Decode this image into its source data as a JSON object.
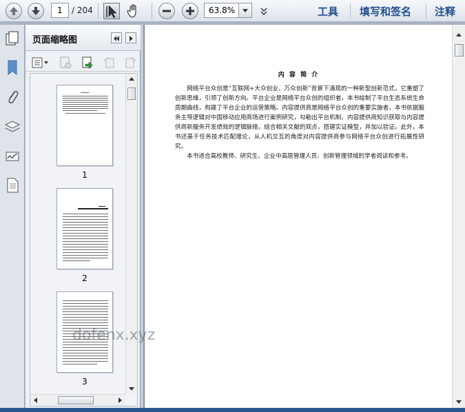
{
  "toolbar": {
    "current_page": "1",
    "total_pages": "/ 204",
    "zoom": "63.8%",
    "links": [
      "工具",
      "填写和签名",
      "注释"
    ]
  },
  "icons": {
    "prev_page": "arrow-up-icon",
    "next_page": "arrow-down-icon",
    "select_tool": "cursor-icon",
    "hand_tool": "hand-icon",
    "zoom_out": "minus-icon",
    "zoom_in": "plus-icon"
  },
  "panel": {
    "title": "页面缩略图",
    "thumbnails": [
      {
        "label": "1"
      },
      {
        "label": "2"
      },
      {
        "label": "3"
      }
    ]
  },
  "document": {
    "title": "内 容 简 介",
    "paragraphs": [
      "网络平台众创是“互联网+大众创业、万众创新”背景下涌现的一种新型创新范式，它重塑了创新思维，引领了创新方向。平台企业是网络平台众创的组织者，本书绘制了平台生态系统生命周期曲线，构建了平台企业的运营策略。内容提供商是网络平台众创的重要实施者，本书依据服务主导逻辑对中国移动应用商场进行案例研究，勾勒出平台机制、内容提供商知识获取与内容提供商新服务开发绩效的逻辑脉络，结合相关文献的观点，搭建实证模型，并加以验证。此外，本书还基于任务技术匹配理论，从人机交互的角度对内容提供商参与网络平台众创进行拓展性研究。",
      "本书适合高校教师、研究生、企业中高层管理人员、创新管理领域的学者阅读和参考。"
    ]
  },
  "watermark": "dofenx.xyz"
}
